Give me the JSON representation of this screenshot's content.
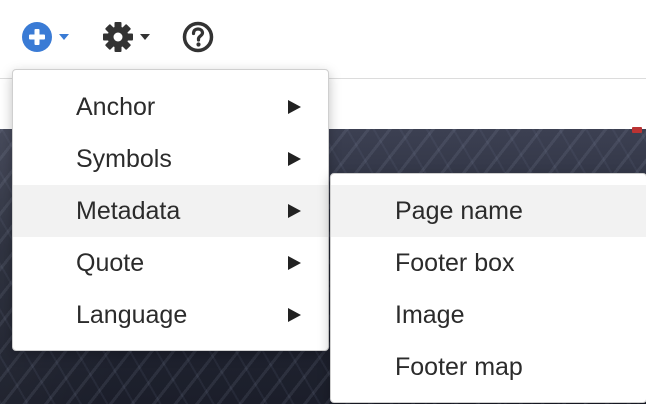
{
  "toolbar": {
    "buttons": [
      {
        "name": "insert",
        "icon": "plus-circle-icon",
        "accent": "#3a7bd5"
      },
      {
        "name": "settings",
        "icon": "gear-icon"
      },
      {
        "name": "help",
        "icon": "question-circle-icon"
      }
    ]
  },
  "insert_menu": {
    "items": [
      {
        "label": "Anchor",
        "has_submenu": true
      },
      {
        "label": "Symbols",
        "has_submenu": true
      },
      {
        "label": "Metadata",
        "has_submenu": true,
        "highlighted": true
      },
      {
        "label": "Quote",
        "has_submenu": true
      },
      {
        "label": "Language",
        "has_submenu": true
      }
    ]
  },
  "metadata_submenu": {
    "items": [
      {
        "label": "Page name",
        "highlighted": true
      },
      {
        "label": "Footer box"
      },
      {
        "label": "Image"
      },
      {
        "label": "Footer map"
      }
    ]
  },
  "colors": {
    "accent": "#3a7bd5",
    "highlight": "#f2f2f2",
    "icon_dark": "#333333"
  }
}
